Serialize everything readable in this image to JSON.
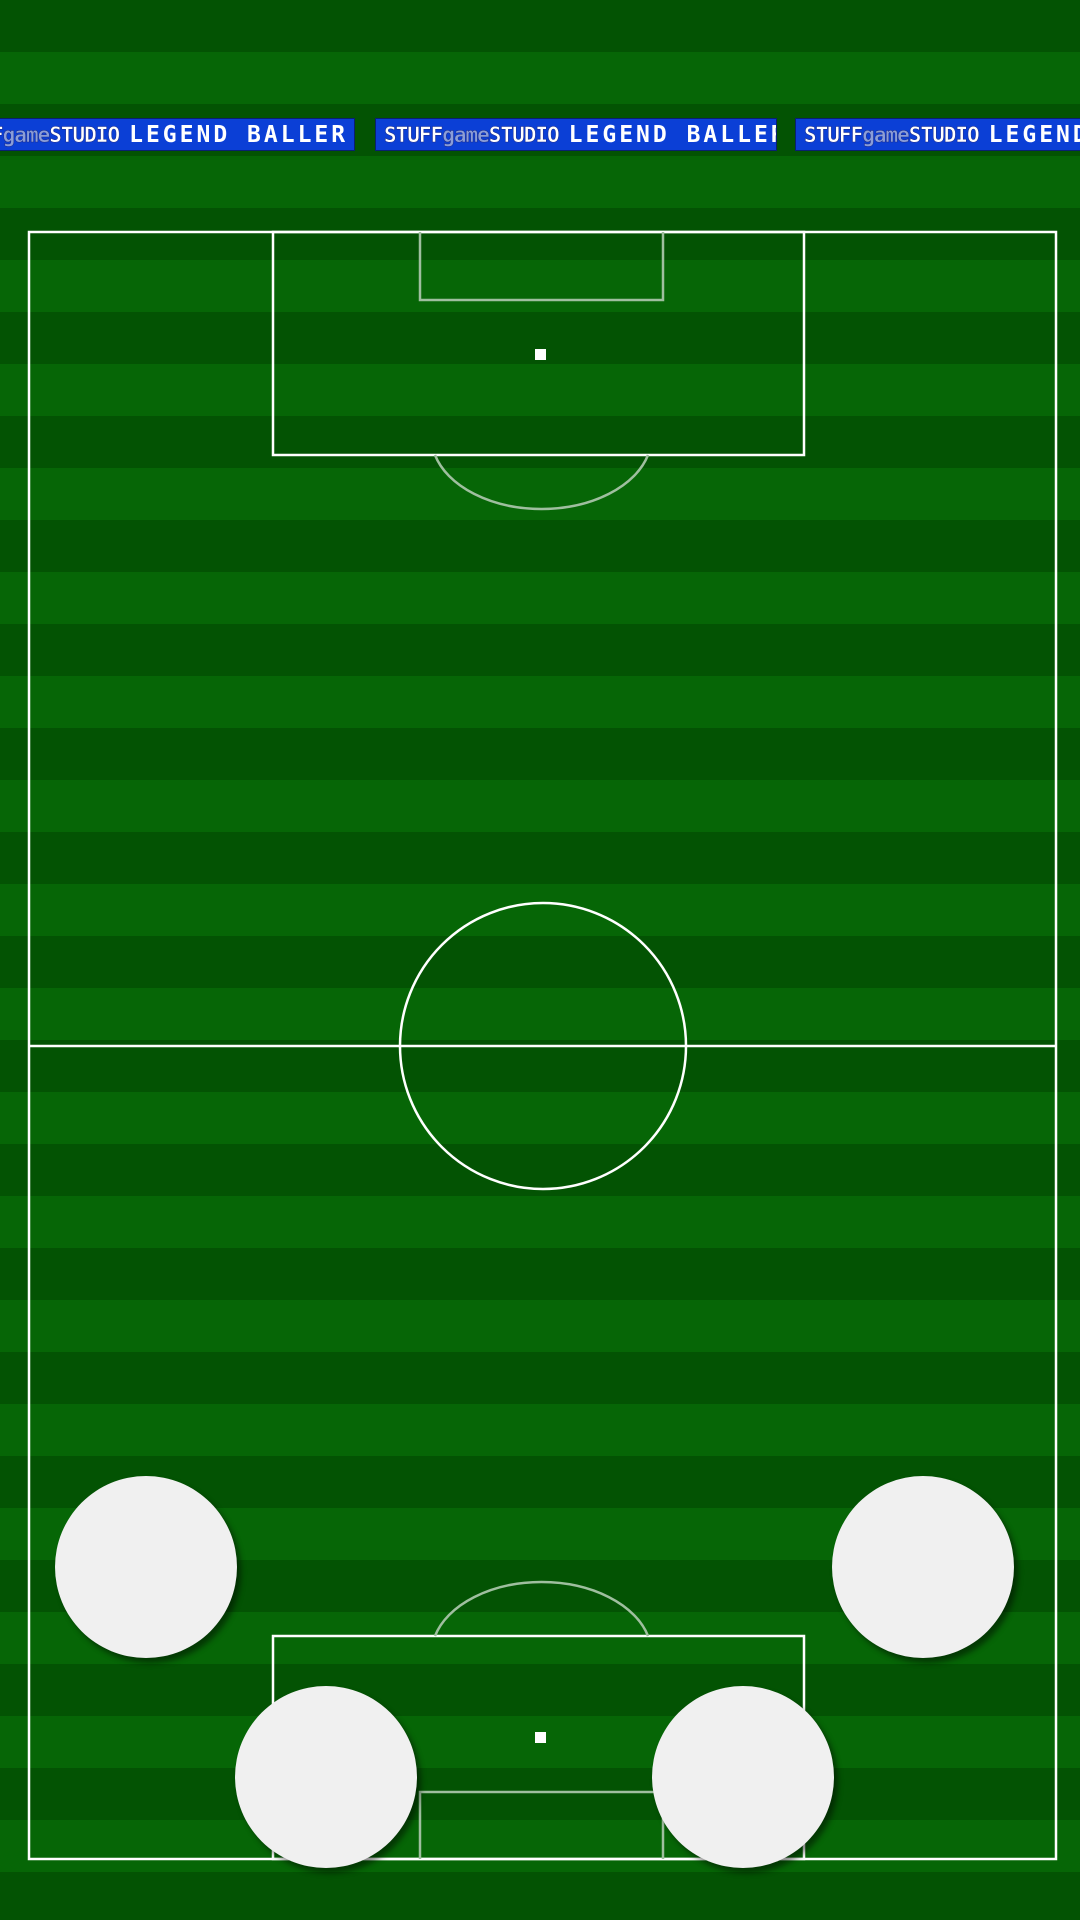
{
  "banners": [
    {
      "studio_prefix": "F",
      "studio_game": "game",
      "studio_suffix": "STUDIO",
      "title": "LEGEND  BALLER"
    },
    {
      "studio_prefix": "STUFF",
      "studio_game": "game",
      "studio_suffix": "STUDIO",
      "title": "LEGEND  BALLER"
    },
    {
      "studio_prefix": "STUFF",
      "studio_game": "game",
      "studio_suffix": "STUDIO",
      "title": "LEGEND"
    }
  ],
  "colors": {
    "grass_dark": "#035303",
    "grass_light": "#066606",
    "banner_blue": "#0b3fd6",
    "line_white": "#ffffff",
    "button_white": "#f0f0f0"
  },
  "controls": {
    "count": 4,
    "icon": "round-touch-button"
  }
}
